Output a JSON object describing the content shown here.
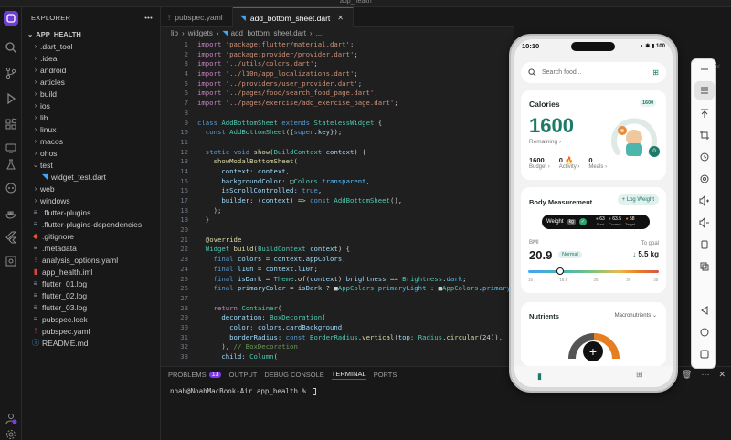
{
  "window": {
    "title": "app_health"
  },
  "explorer": {
    "header": "EXPLORER",
    "root": "APP_HEALTH",
    "items": [
      {
        "label": ".dart_tool",
        "kind": "folder",
        "depth": 0,
        "open": false
      },
      {
        "label": ".idea",
        "kind": "folder",
        "depth": 0,
        "open": false
      },
      {
        "label": "android",
        "kind": "folder",
        "depth": 0,
        "open": false
      },
      {
        "label": "articles",
        "kind": "folder",
        "depth": 0,
        "open": false
      },
      {
        "label": "build",
        "kind": "folder",
        "depth": 0,
        "open": false
      },
      {
        "label": "ios",
        "kind": "folder",
        "depth": 0,
        "open": false
      },
      {
        "label": "lib",
        "kind": "folder",
        "depth": 0,
        "open": false
      },
      {
        "label": "linux",
        "kind": "folder",
        "depth": 0,
        "open": false
      },
      {
        "label": "macos",
        "kind": "folder",
        "depth": 0,
        "open": false
      },
      {
        "label": "ohos",
        "kind": "folder",
        "depth": 0,
        "open": false
      },
      {
        "label": "test",
        "kind": "folder",
        "depth": 0,
        "open": true
      },
      {
        "label": "widget_test.dart",
        "kind": "dart",
        "depth": 1
      },
      {
        "label": "web",
        "kind": "folder",
        "depth": 0,
        "open": false
      },
      {
        "label": "windows",
        "kind": "folder",
        "depth": 0,
        "open": false
      },
      {
        "label": ".flutter-plugins",
        "kind": "file",
        "depth": 0
      },
      {
        "label": ".flutter-plugins-dependencies",
        "kind": "file",
        "depth": 0
      },
      {
        "label": ".gitignore",
        "kind": "git",
        "depth": 0
      },
      {
        "label": ".metadata",
        "kind": "file",
        "depth": 0
      },
      {
        "label": "analysis_options.yaml",
        "kind": "yaml",
        "depth": 0
      },
      {
        "label": "app_health.iml",
        "kind": "iml",
        "depth": 0
      },
      {
        "label": "flutter_01.log",
        "kind": "file",
        "depth": 0
      },
      {
        "label": "flutter_02.log",
        "kind": "file",
        "depth": 0
      },
      {
        "label": "flutter_03.log",
        "kind": "file",
        "depth": 0
      },
      {
        "label": "pubspec.lock",
        "kind": "file",
        "depth": 0
      },
      {
        "label": "pubspec.yaml",
        "kind": "yaml",
        "depth": 0
      },
      {
        "label": "README.md",
        "kind": "info",
        "depth": 0
      }
    ]
  },
  "tabs": [
    {
      "label": "pubspec.yaml",
      "active": false
    },
    {
      "label": "add_bottom_sheet.dart",
      "active": true
    }
  ],
  "breadcrumb": [
    "lib",
    "widgets",
    "add_bottom_sheet.dart",
    "..."
  ],
  "code_lines": [
    {
      "n": "1",
      "html": "<span class='kw2'>import</span> <span class='str'>'package:flutter/material.dart'</span>;"
    },
    {
      "n": "2",
      "html": "<span class='kw2'>import</span> <span class='str'>'package:provider/provider.dart'</span>;"
    },
    {
      "n": "3",
      "html": "<span class='kw2'>import</span> <span class='str'>'../utils/colors.dart'</span>;"
    },
    {
      "n": "4",
      "html": "<span class='kw2'>import</span> <span class='str'>'../l10n/app_localizations.dart'</span>;"
    },
    {
      "n": "5",
      "html": "<span class='kw2'>import</span> <span class='str'>'../providers/user_provider.dart'</span>;"
    },
    {
      "n": "6",
      "html": "<span class='kw2'>import</span> <span class='str'>'../pages/food/search_food_page.dart'</span>;"
    },
    {
      "n": "7",
      "html": "<span class='kw2'>import</span> <span class='str'>'../pages/exercise/add_exercise_page.dart'</span>;"
    },
    {
      "n": "8",
      "html": ""
    },
    {
      "n": "9",
      "html": "<span class='kw'>class</span> <span class='ty'>AddBottomSheet</span> <span class='kw'>extends</span> <span class='ty'>StatelessWidget</span> {"
    },
    {
      "n": "10",
      "html": "  <span class='kw'>const</span> <span class='ty'>AddBottomSheet</span>({<span class='kw'>super</span>.<span class='vr'>key</span>});"
    },
    {
      "n": "11",
      "html": ""
    },
    {
      "n": "12",
      "html": "  <span class='kw'>static</span> <span class='kw'>void</span> <span class='fn'>show</span>(<span class='ty'>BuildContext</span> <span class='vr'>context</span>) {"
    },
    {
      "n": "13",
      "html": "    <span class='fn'>showModalBottomSheet</span>("
    },
    {
      "n": "14",
      "html": "      <span class='vr'>context</span>: <span class='vr'>context</span>,"
    },
    {
      "n": "15",
      "html": "      <span class='vr'>backgroundColor</span>: &#9633;<span class='ty'>Colors</span>.<span class='cn'>transparent</span>,"
    },
    {
      "n": "16",
      "html": "      <span class='vr'>isScrollControlled</span>: <span class='kw'>true</span>,"
    },
    {
      "n": "17",
      "html": "      <span class='vr'>builder</span>: (<span class='vr'>context</span>) =&gt; <span class='kw'>const</span> <span class='ty'>AddBottomSheet</span>(),"
    },
    {
      "n": "18",
      "html": "    );"
    },
    {
      "n": "19",
      "html": "  }"
    },
    {
      "n": "20",
      "html": ""
    },
    {
      "n": "21",
      "html": "  <span class='fn'>@override</span>"
    },
    {
      "n": "22",
      "html": "  <span class='ty'>Widget</span> <span class='fn'>build</span>(<span class='ty'>BuildContext</span> <span class='vr'>context</span>) {"
    },
    {
      "n": "23",
      "html": "    <span class='kw'>final</span> <span class='vr'>colors</span> = <span class='vr'>context</span>.<span class='vr'>appColors</span>;"
    },
    {
      "n": "24",
      "html": "    <span class='kw'>final</span> <span class='vr'>l10n</span> = <span class='vr'>context</span>.<span class='vr'>l10n</span>;"
    },
    {
      "n": "25",
      "html": "    <span class='kw'>final</span> <span class='vr'>isDark</span> = <span class='ty'>Theme</span>.<span class='fn'>of</span>(<span class='vr'>context</span>).<span class='vr'>brightness</span> == <span class='ty'>Brightness</span>.<span class='cn'>dark</span>;"
    },
    {
      "n": "26",
      "html": "    <span class='kw'>final</span> <span class='vr'>primaryColor</span> = <span class='vr'>isDark</span> ? &#9632;<span class='ty'>AppColors</span>.<span class='cn'>primaryLight</span> : &#9632;<span class='ty'>AppColors</span>.<span class='cn'>primaryDark</span>;"
    },
    {
      "n": "27",
      "html": ""
    },
    {
      "n": "28",
      "html": "    <span class='kw2'>return</span> <span class='ty'>Container</span>("
    },
    {
      "n": "29",
      "html": "      <span class='vr'>decoration</span>: <span class='ty'>BoxDecoration</span>("
    },
    {
      "n": "30",
      "html": "        <span class='vr'>color</span>: <span class='vr'>colors</span>.<span class='vr'>cardBackground</span>,"
    },
    {
      "n": "31",
      "html": "        <span class='vr'>borderRadius</span>: <span class='kw'>const</span> <span class='ty'>BorderRadius</span>.<span class='fn'>vertical</span>(<span class='vr'>top</span>: <span class='ty'>Radius</span>.<span class='fn'>circular</span>(24)),"
    },
    {
      "n": "32",
      "html": "      ), <span class='cm'>// BoxDecoration</span>"
    },
    {
      "n": "33",
      "html": "      <span class='vr'>child</span>: <span class='ty'>Column</span>("
    }
  ],
  "panel": {
    "tabs": [
      {
        "label": "PROBLEMS",
        "badge": "13",
        "active": false
      },
      {
        "label": "OUTPUT",
        "active": false
      },
      {
        "label": "DEBUG CONSOLE",
        "active": false
      },
      {
        "label": "TERMINAL",
        "active": true
      },
      {
        "label": "PORTS",
        "active": false
      }
    ],
    "terminal_prompt": "noah@NoahMacBook-Air app_health % "
  },
  "phone": {
    "time": "10:10",
    "status_right": "100",
    "search_placeholder": "Search food...",
    "calories": {
      "title": "Calories",
      "remaining_value": "1600",
      "remaining_label": "Remaining",
      "ring_value": "1600",
      "ring_bottom": "0",
      "stats": [
        {
          "value": "1600",
          "label": "Budget"
        },
        {
          "value": "0",
          "label": "Activity"
        },
        {
          "value": "0",
          "label": "Meals"
        }
      ],
      "ops": [
        "+",
        "-"
      ]
    },
    "body": {
      "title": "Body Measurement",
      "log_button": "+ Log Weight",
      "weight_label": "Weight",
      "weight_unit": "kg",
      "weights": [
        {
          "value": "63",
          "label": "Start",
          "color": "#9e9e9e"
        },
        {
          "value": "63.5",
          "label": "Current",
          "color": "#2ea36b"
        },
        {
          "value": "58",
          "label": "Target",
          "color": "#e67e22"
        }
      ],
      "bmi_label": "BMI",
      "bmi_value": "20.9",
      "bmi_status": "Normal",
      "goal_label": "To goal",
      "goal_value": "5.5 kg",
      "scale_ticks": [
        "15",
        "18.5",
        "25",
        "30",
        "35"
      ]
    },
    "nutrients": {
      "title": "Nutrients",
      "dropdown": "Macronutrients"
    }
  },
  "colors": {
    "accent": "#0078d4",
    "phone_green": "#1e7a68",
    "phone_orange": "#e67e22"
  }
}
